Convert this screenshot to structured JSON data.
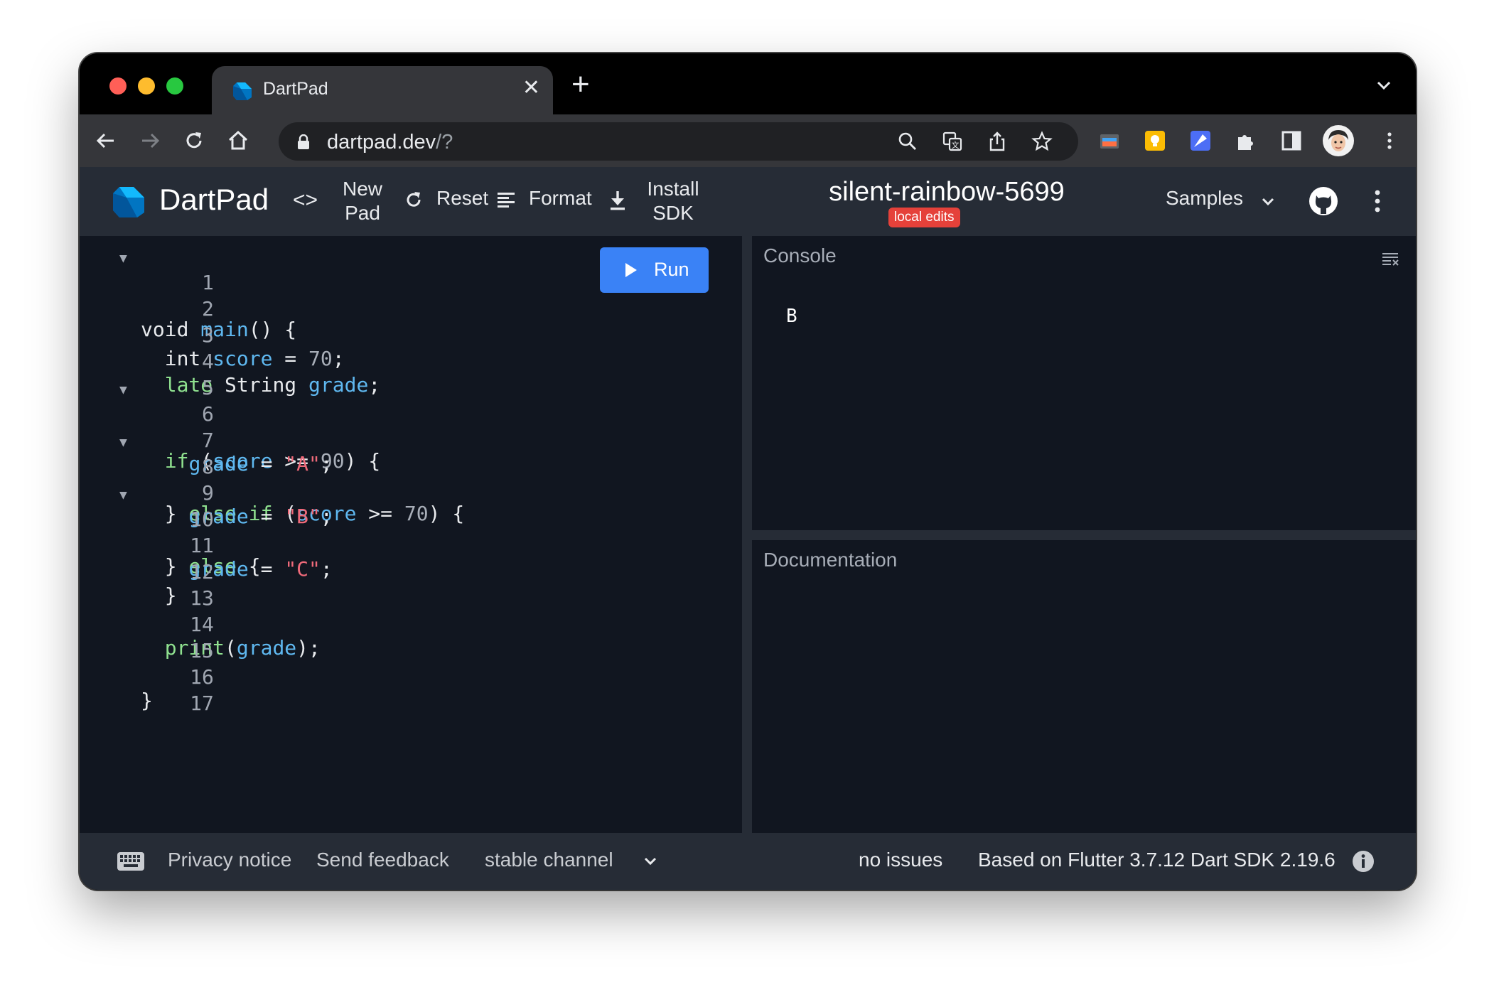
{
  "browser": {
    "tab_title": "DartPad",
    "url_host": "dartpad.dev",
    "url_rest": "/?"
  },
  "header": {
    "brand": "DartPad",
    "new_pad_line1": "New",
    "new_pad_line2": "Pad",
    "reset_label": "Reset",
    "format_label": "Format",
    "install_line1": "Install",
    "install_line2": "SDK",
    "pad_name": "silent-rainbow-5699",
    "badge": "local edits",
    "samples_label": "Samples"
  },
  "editor": {
    "run_label": "Run",
    "line_numbers": [
      "1",
      "2",
      "3",
      "4",
      "5",
      "6",
      "7",
      "8",
      "9",
      "10",
      "11",
      "12",
      "13",
      "14",
      "15",
      "16",
      "17"
    ]
  },
  "console": {
    "title": "Console",
    "output": "B"
  },
  "docs": {
    "title": "Documentation"
  },
  "footer": {
    "privacy": "Privacy notice",
    "feedback": "Send feedback",
    "channel": "stable channel",
    "issues": "no issues",
    "version": "Based on Flutter 3.7.12 Dart SDK 2.19.6"
  },
  "colors": {
    "accent": "#3a82f6",
    "badge": "#e5413a",
    "keyword": "#8fe08f",
    "identifier": "#5fb8f0",
    "string": "#ef6a7a"
  }
}
